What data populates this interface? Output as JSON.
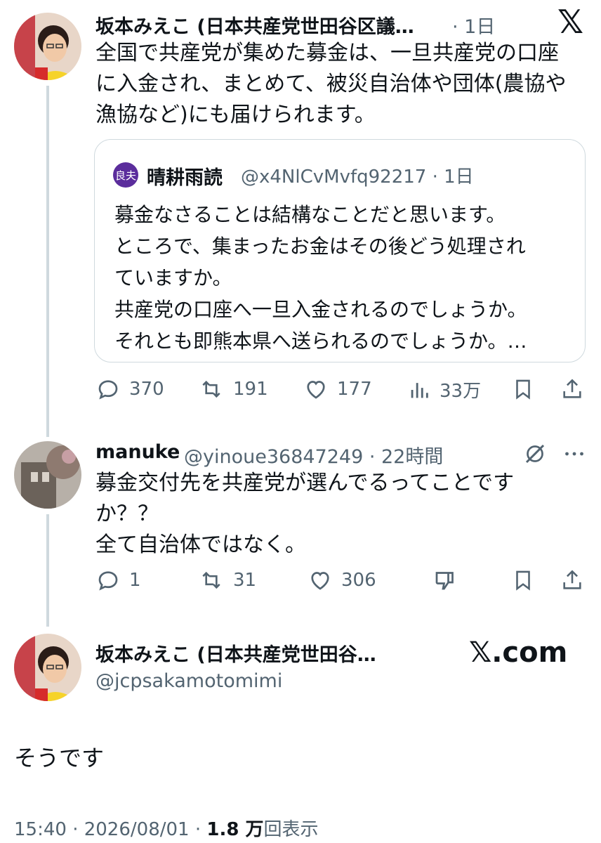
{
  "tweet1": {
    "author_name": "坂本みえこ (日本共産党世田谷区議…",
    "time": "· 1日",
    "text_lines": [
      "全国で共産党が集めた募金は、一旦共産党の口座",
      "に入金され、まとめて、被災自治体や団体(農協や",
      "漁協など)にも届けられます。"
    ],
    "quote": {
      "badge": "良夫",
      "name": "晴耕雨読",
      "handle_time": "@x4NlCvMvfq92217 · 1日",
      "text_lines": [
        "募金なさることは結構なことだと思います。",
        "ところで、集まったお金はその後どう処理され",
        "ていますか。",
        "共産党の口座へ一旦入金されるのでしょうか。",
        "それとも即熊本県へ送られるのでしょうか。…"
      ]
    },
    "actions": {
      "replies": "370",
      "retweets": "191",
      "likes": "177",
      "views": "33万"
    }
  },
  "tweet2": {
    "author_name": "manuke",
    "handle_time": "@yinoue36847249 · 22時間",
    "text_lines": [
      "募金交付先を共産党が選んでるってことです",
      "か？？",
      "全て自治体ではなく。"
    ],
    "actions": {
      "replies": "1",
      "retweets": "31",
      "likes": "306"
    }
  },
  "tweet3": {
    "author_name": "坂本みえこ (日本共産党世田谷…",
    "handle": "@jcpsakamotomimi",
    "text": "そうです",
    "footer_time": "15:40 · 2026/08/01 · ",
    "footer_views": "1.8 万",
    "footer_suffix": "回表示"
  },
  "brand": {
    "logo": "𝕏",
    "watermark": "𝕏.com"
  },
  "colors": {
    "text": "#0f1419",
    "muted": "#536471",
    "border": "#cfd9de",
    "badge": "#5b2d9c"
  }
}
